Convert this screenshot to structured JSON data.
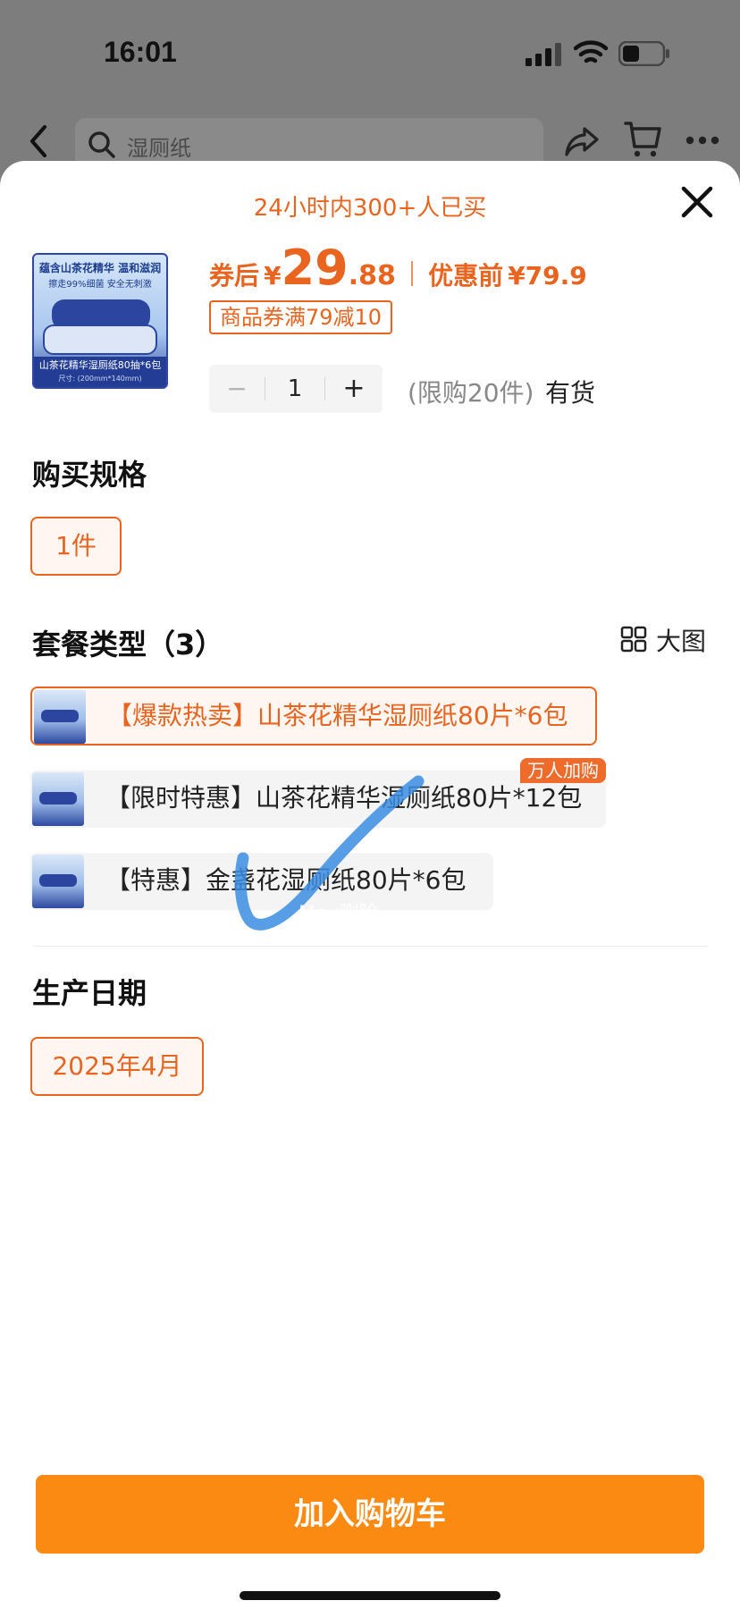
{
  "status_bar": {
    "time": "16:01"
  },
  "nav": {
    "search_placeholder": "湿厕纸"
  },
  "sheet": {
    "buyers_text": "24小时内300+人已买",
    "thumb": {
      "headline": "蕴含山茶花精华 温和滋润",
      "subline": "擦走99%细菌 安全无刺激",
      "bar_title": "山茶花精华湿厕纸80抽*6包",
      "bar_size": "尺寸: (200mm*140mm)"
    },
    "price": {
      "after_label": "券后",
      "currency": "¥",
      "integer": "29",
      "decimal": ".88",
      "before_label": "优惠前",
      "before_value": "¥79.9"
    },
    "coupon": "商品券满79减10",
    "quantity": {
      "minus": "−",
      "value": "1",
      "plus": "+"
    },
    "limit_text": "(限购20件)",
    "stock_text": "有货",
    "spec": {
      "title": "购买规格",
      "option": "1件"
    },
    "package": {
      "title": "套餐类型（3）",
      "big_view_label": "大图",
      "items": [
        {
          "label": "【爆款热卖】山茶花精华湿厕纸80片*6包",
          "selected": true
        },
        {
          "label": "【限时特惠】山茶花精华湿厕纸80片*12包",
          "badge": "万人加购",
          "selected": false
        },
        {
          "label": "【特惠】金盏花湿厕纸80片*6包",
          "selected": false
        }
      ]
    },
    "date": {
      "title": "生产日期",
      "option": "2025年4月"
    },
    "add_to_cart": "加入购物车"
  },
  "overlay": {
    "watermark": "May删除"
  },
  "colors": {
    "accent": "#e8641f",
    "button": "#fb8a13",
    "badge": "#ef6b2b",
    "checkmark": "#3a8de3"
  }
}
